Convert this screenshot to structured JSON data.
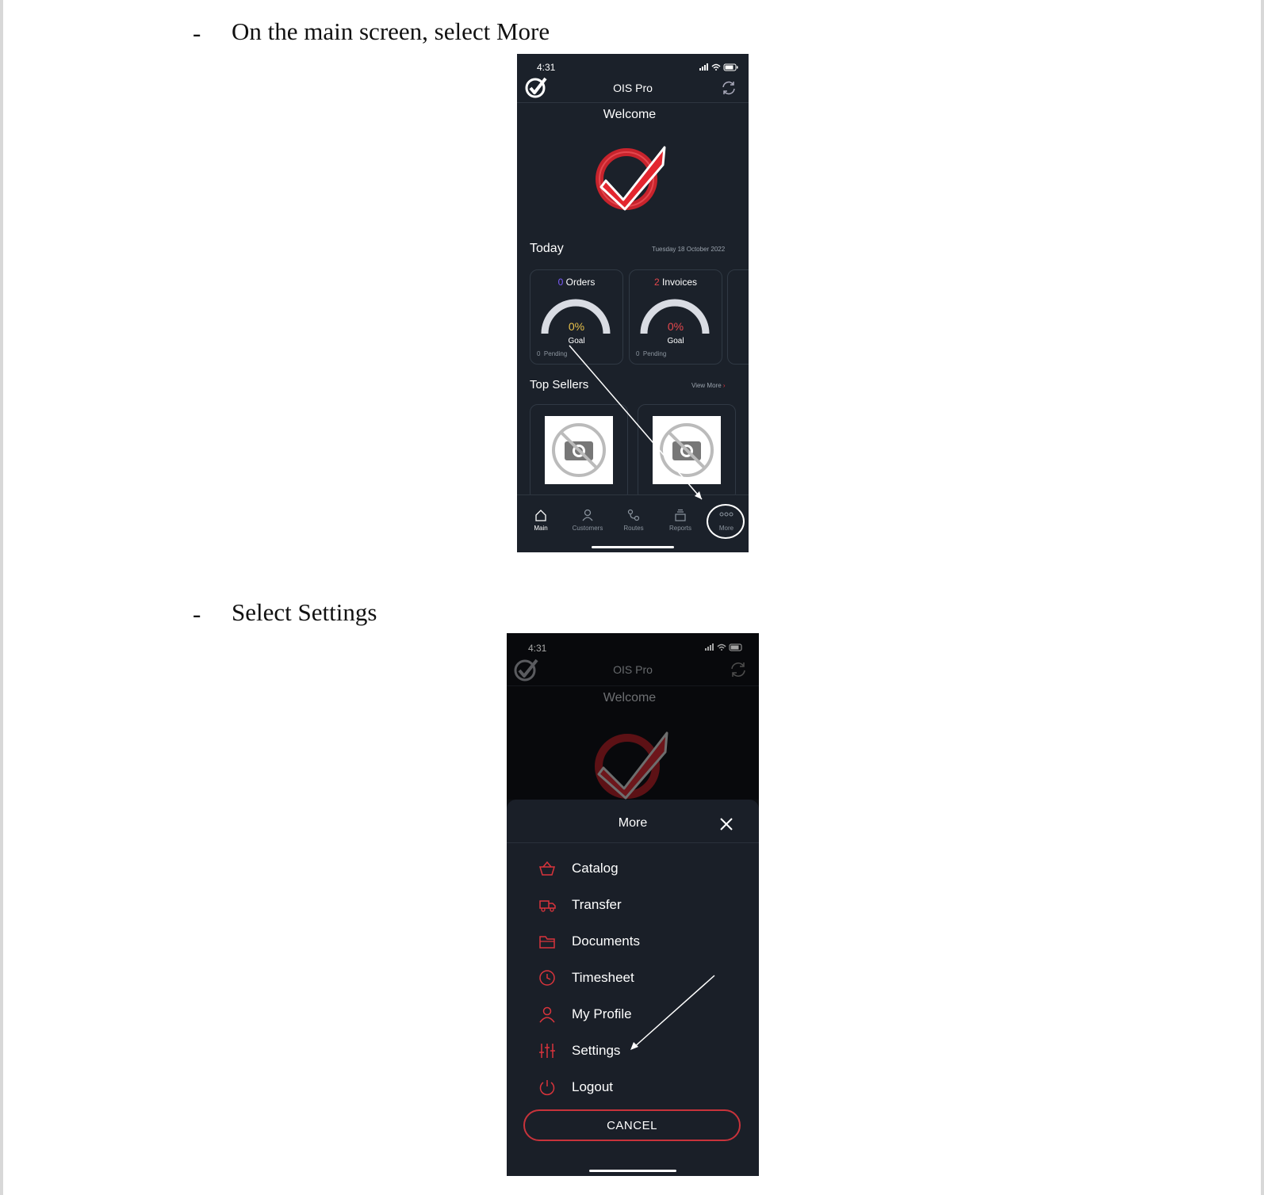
{
  "document": {
    "step1": {
      "bullet": "-",
      "text": "On the main screen, select More"
    },
    "step2": {
      "bullet": "-",
      "text": "Select Settings"
    }
  },
  "screen1": {
    "status_time": "4:31",
    "app_title": "OIS Pro",
    "welcome": "Welcome",
    "today_label": "Today",
    "date": "Tuesday 18 October 2022",
    "cards": [
      {
        "count": "0",
        "label": "Orders",
        "percent": "0%",
        "goal": "Goal",
        "pending_count": "0",
        "pending_label": "Pending",
        "count_color": "#7c5cff",
        "percent_color": "#e8c14a"
      },
      {
        "count": "2",
        "label": "Invoices",
        "percent": "0%",
        "goal": "Goal",
        "pending_count": "0",
        "pending_label": "Pending",
        "count_color": "#e5484d",
        "percent_color": "#e5484d"
      }
    ],
    "top_sellers": "Top Sellers",
    "view_more": "View More",
    "tabs": [
      {
        "label": "Main",
        "icon": "home-icon"
      },
      {
        "label": "Customers",
        "icon": "person-icon"
      },
      {
        "label": "Routes",
        "icon": "route-icon"
      },
      {
        "label": "Reports",
        "icon": "reports-icon"
      },
      {
        "label": "More",
        "icon": "more-dots-icon"
      }
    ]
  },
  "screen2": {
    "status_time": "4:31",
    "app_title": "OIS Pro",
    "welcome": "Welcome",
    "sheet_title": "More",
    "menu": [
      {
        "label": "Catalog",
        "icon": "basket-icon"
      },
      {
        "label": "Transfer",
        "icon": "truck-icon"
      },
      {
        "label": "Documents",
        "icon": "folder-icon"
      },
      {
        "label": "Timesheet",
        "icon": "clock-icon"
      },
      {
        "label": "My Profile",
        "icon": "person-icon"
      },
      {
        "label": "Settings",
        "icon": "sliders-icon"
      },
      {
        "label": "Logout",
        "icon": "power-icon"
      }
    ],
    "cancel": "CANCEL"
  },
  "colors": {
    "accent": "#d9343c",
    "phone_bg": "#1b212a",
    "sheet_bg": "#1a1f28"
  }
}
